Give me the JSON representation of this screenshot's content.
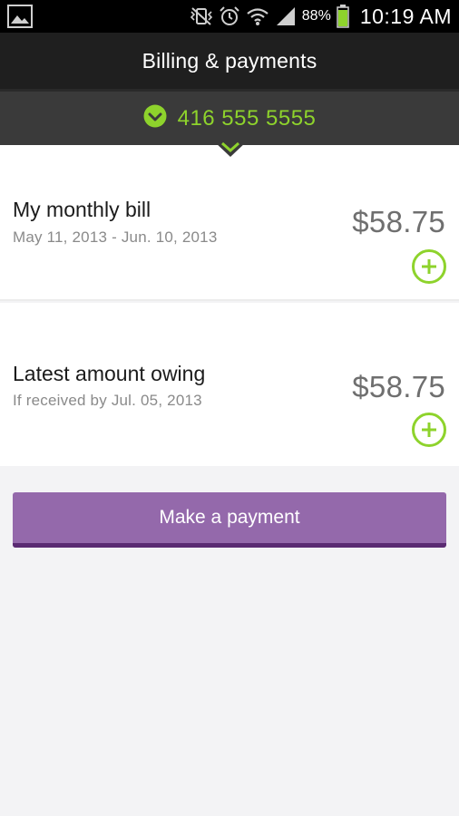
{
  "status_bar": {
    "battery_percent": "88%",
    "time": "10:19 AM",
    "icons": [
      "image-notification-icon",
      "mute-vibrate-icon",
      "alarm-icon",
      "wifi-icon",
      "signal-icon",
      "battery-icon"
    ]
  },
  "header": {
    "title": "Billing & payments"
  },
  "account": {
    "number": "416 555 5555",
    "icon": "check-circle-icon"
  },
  "bills": [
    {
      "title": "My monthly bill",
      "subtitle": "May 11, 2013 - Jun. 10, 2013",
      "amount": "$58.75"
    },
    {
      "title": "Latest amount owing",
      "subtitle": "If received by Jul. 05, 2013",
      "amount": "$58.75"
    }
  ],
  "actions": {
    "make_payment": "Make a payment"
  },
  "colors": {
    "accent_green": "#8ed32c",
    "button_purple": "#9469ab",
    "button_purple_dark": "#5a2a72",
    "header_bg": "#1f1f1f",
    "account_bar_bg": "#3a3a3a"
  }
}
